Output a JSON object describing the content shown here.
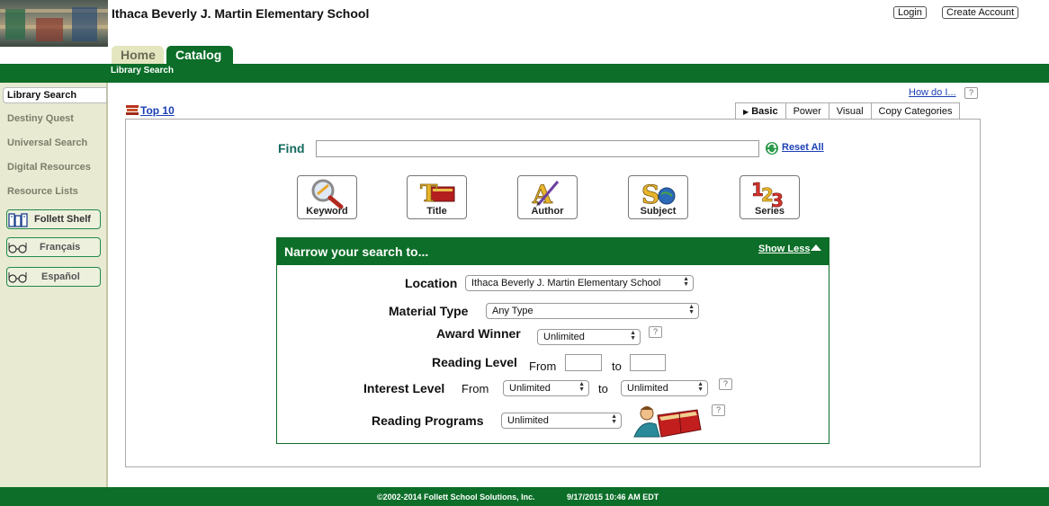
{
  "header": {
    "school_name": "Ithaca Beverly J. Martin Elementary School",
    "login_label": "Login",
    "create_account_label": "Create Account"
  },
  "tabs": [
    {
      "label": "Home"
    },
    {
      "label": "Catalog"
    }
  ],
  "subnav": {
    "label": "Library Search"
  },
  "sidebar": {
    "items": [
      {
        "label": "Library Search"
      },
      {
        "label": "Destiny Quest"
      },
      {
        "label": "Universal Search"
      },
      {
        "label": "Digital Resources"
      },
      {
        "label": "Resource Lists"
      }
    ],
    "buttons": [
      {
        "label": "Follett Shelf"
      },
      {
        "label": "Français"
      },
      {
        "label": "Español"
      }
    ]
  },
  "main": {
    "top10_label": "Top 10",
    "howdo_label": "How do I...",
    "help_glyph": "?",
    "mode_tabs": [
      {
        "label": "Basic",
        "active": true
      },
      {
        "label": "Power"
      },
      {
        "label": "Visual"
      },
      {
        "label": "Copy Categories"
      }
    ],
    "find_label": "Find",
    "find_value": "",
    "reset_label": "Reset All",
    "search_buttons": [
      {
        "label": "Keyword",
        "icon": "magnifier-icon"
      },
      {
        "label": "Title",
        "icon": "title-book-icon"
      },
      {
        "label": "Author",
        "icon": "author-pen-icon"
      },
      {
        "label": "Subject",
        "icon": "subject-letters-icon"
      },
      {
        "label": "Series",
        "icon": "series-numbers-icon"
      }
    ],
    "narrow": {
      "title": "Narrow your search to...",
      "show_less_label": "Show Less",
      "location_label": "Location",
      "location_value": "Ithaca Beverly J. Martin Elementary School",
      "material_type_label": "Material Type",
      "material_type_value": "Any Type",
      "award_winner_label": "Award Winner",
      "award_winner_value": "Unlimited",
      "reading_level_label": "Reading Level",
      "reading_from_label": "From",
      "reading_to_label": "to",
      "interest_level_label": "Interest Level",
      "interest_from_label": "From",
      "interest_from_value": "Unlimited",
      "interest_to_label": "to",
      "interest_to_value": "Unlimited",
      "reading_programs_label": "Reading Programs",
      "reading_programs_value": "Unlimited"
    }
  },
  "footer": {
    "copyright": "©2002-2014  Follett School Solutions, Inc.",
    "timestamp": "9/17/2015 10:46 AM EDT"
  },
  "colors": {
    "brand_green": "#0c6e28",
    "link_blue": "#1a3fb5",
    "sidebar_bg": "#e8ead2"
  }
}
